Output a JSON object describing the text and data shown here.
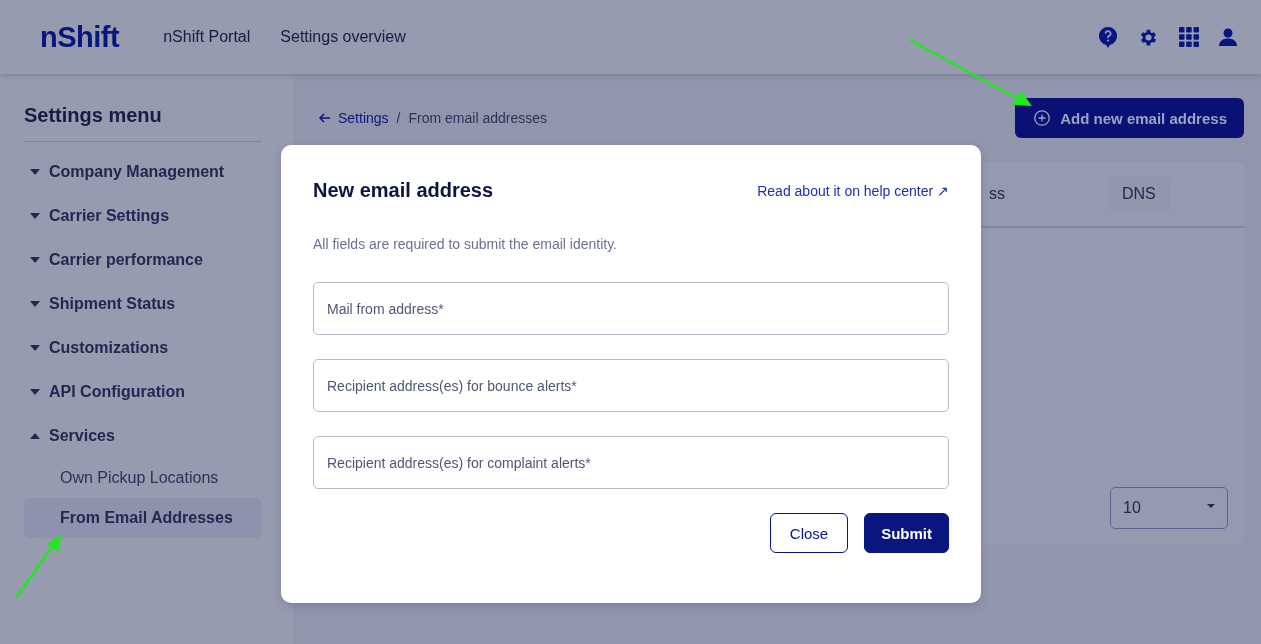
{
  "header": {
    "logo": "nShift",
    "nav": [
      "nShift Portal",
      "Settings overview"
    ]
  },
  "sidebar": {
    "title": "Settings menu",
    "items": [
      {
        "label": "Company Management",
        "expanded": false
      },
      {
        "label": "Carrier Settings",
        "expanded": false
      },
      {
        "label": "Carrier performance",
        "expanded": false
      },
      {
        "label": "Shipment Status",
        "expanded": false
      },
      {
        "label": "Customizations",
        "expanded": false
      },
      {
        "label": "API Configuration",
        "expanded": false
      },
      {
        "label": "Services",
        "expanded": true,
        "children": [
          {
            "label": "Own Pickup Locations",
            "selected": false
          },
          {
            "label": "From Email Addresses",
            "selected": true
          }
        ]
      }
    ]
  },
  "breadcrumb": {
    "back": "Settings",
    "separator": "/",
    "current": "From email addresses"
  },
  "add_button": "Add new email address",
  "table": {
    "columns": [
      "ss",
      "DNS"
    ]
  },
  "page_size": "10",
  "modal": {
    "title": "New email address",
    "help_link": "Read about it on help center ↗",
    "note": "All fields are required to submit the email identity.",
    "fields": [
      {
        "placeholder": "Mail from address*"
      },
      {
        "placeholder": "Recipient address(es) for bounce alerts*"
      },
      {
        "placeholder": "Recipient address(es) for complaint alerts*"
      }
    ],
    "buttons": [
      {
        "label": "Close",
        "kind": "secondary"
      },
      {
        "label": "Submit",
        "kind": "primary"
      }
    ]
  }
}
